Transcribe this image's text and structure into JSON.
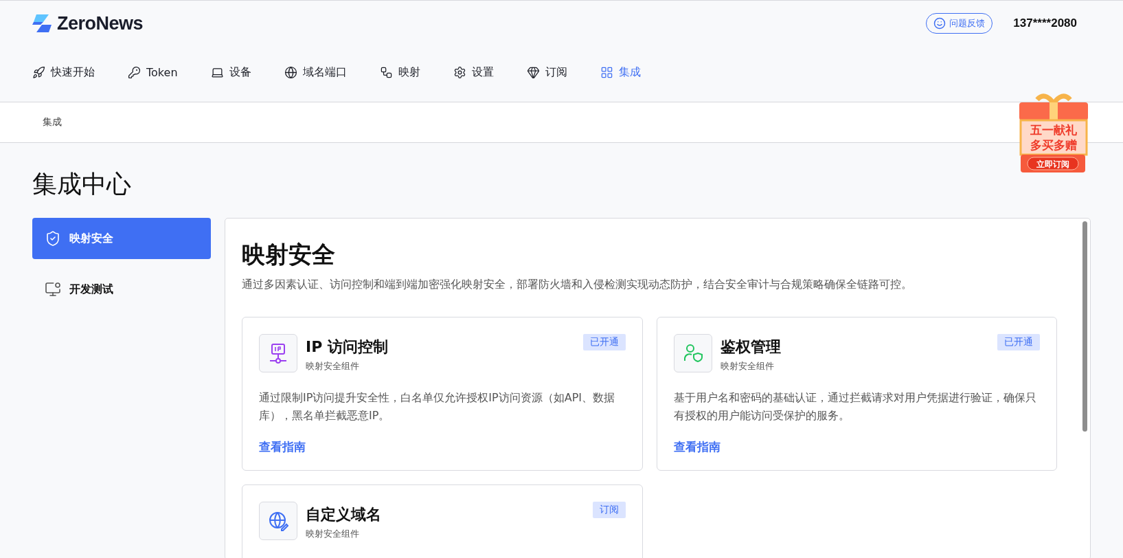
{
  "header": {
    "logo": "ZeroNews",
    "feedback_button": "问题反馈",
    "user": "137****2080"
  },
  "nav": [
    {
      "label": "快速开始",
      "selected": false
    },
    {
      "label": "Token",
      "selected": false
    },
    {
      "label": "设备",
      "selected": false
    },
    {
      "label": "域名端口",
      "selected": false
    },
    {
      "label": "映射",
      "selected": false
    },
    {
      "label": "设置",
      "selected": false
    },
    {
      "label": "订阅",
      "selected": false
    },
    {
      "label": "集成",
      "selected": true
    }
  ],
  "breadcrumb": "集成",
  "promo": {
    "line_1": "五一献礼",
    "line_2": "多买多赠",
    "button": "立即订阅"
  },
  "page_title": "集成中心",
  "sidebar": [
    {
      "label": "映射安全",
      "selected": true
    },
    {
      "label": "开发测试",
      "selected": false
    }
  ],
  "section": {
    "title": "映射安全",
    "description": "通过多因素认证、访问控制和端到端加密强化映射安全，部署防火墙和入侵检测实现动态防护，结合安全审计与合规策略确保全链路可控。",
    "cards": [
      {
        "title": "IP 访问控制",
        "subtitle": "映射安全组件",
        "badge": "已开通",
        "description": "通过限制IP访问提升安全性，白名单仅允许授权IP访问资源（如API、数据库），黑名单拦截恶意IP。",
        "link": "查看指南"
      },
      {
        "title": "鉴权管理",
        "subtitle": "映射安全组件",
        "badge": "已开通",
        "description": "基于用户名和密码的基础认证，通过拦截请求对用户凭据进行验证，确保只有授权的用户能访问受保护的服务。",
        "link": "查看指南"
      },
      {
        "title": "自定义域名",
        "subtitle": "映射安全组件",
        "badge": "订阅"
      }
    ]
  }
}
